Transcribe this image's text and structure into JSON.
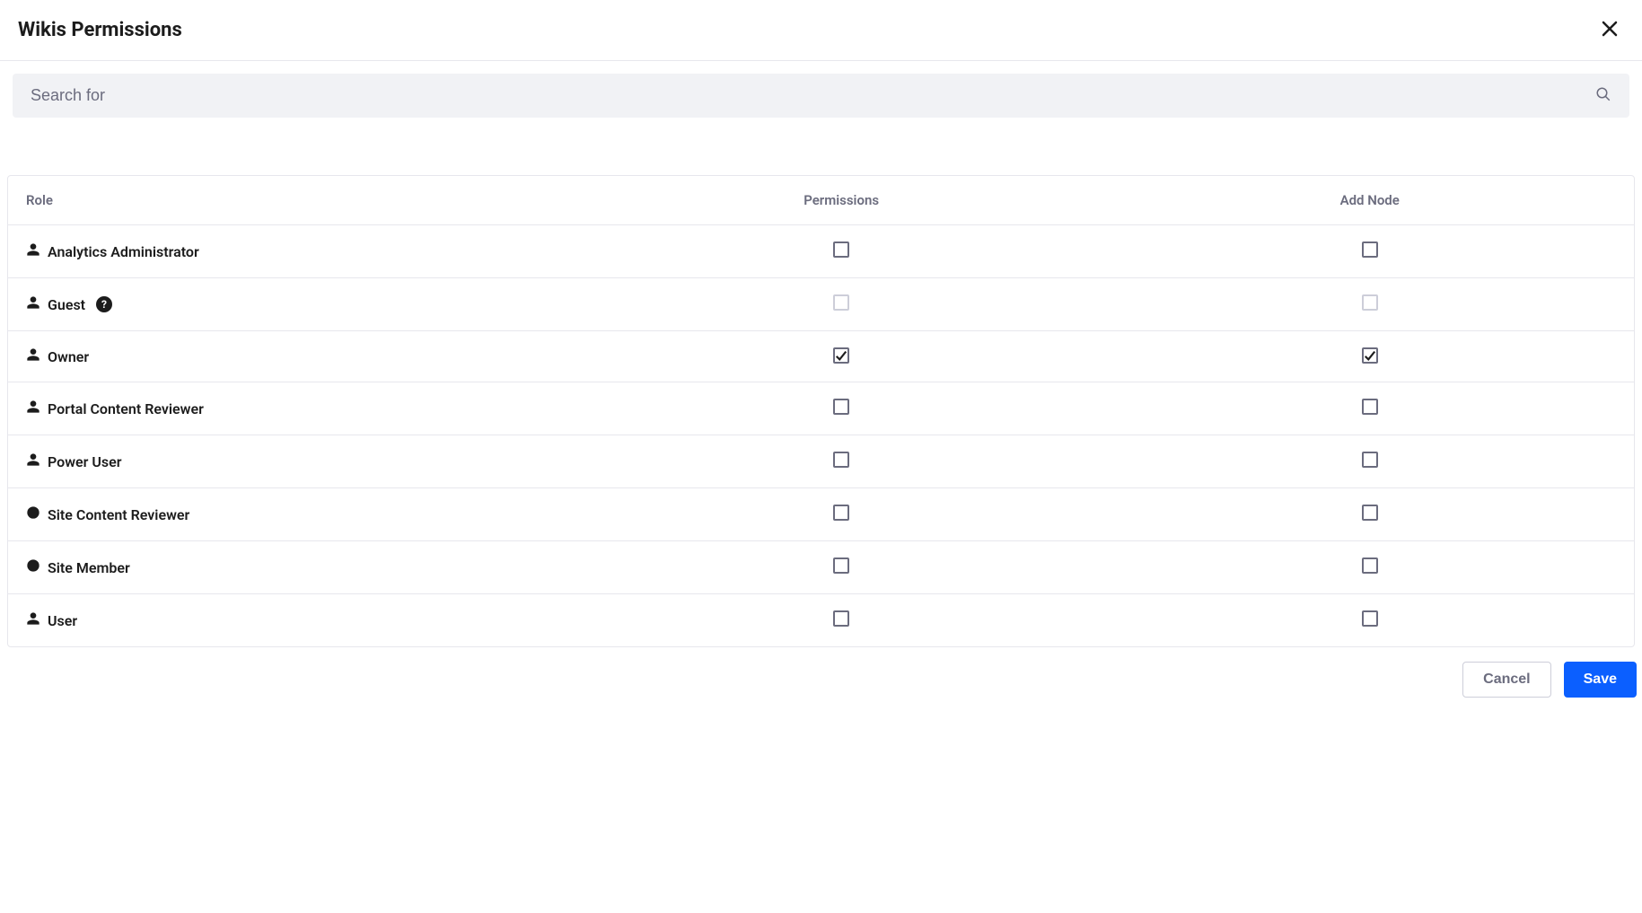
{
  "header": {
    "title": "Wikis Permissions"
  },
  "search": {
    "placeholder": "Search for"
  },
  "table": {
    "columns": {
      "role": "Role",
      "permissions": "Permissions",
      "addNode": "Add Node"
    },
    "rows": [
      {
        "iconType": "user",
        "label": "Analytics Administrator",
        "hasHelp": false,
        "permissions": false,
        "addNode": false,
        "disabled": false
      },
      {
        "iconType": "user",
        "label": "Guest",
        "hasHelp": true,
        "permissions": false,
        "addNode": false,
        "disabled": true
      },
      {
        "iconType": "user",
        "label": "Owner",
        "hasHelp": false,
        "permissions": true,
        "addNode": true,
        "disabled": false
      },
      {
        "iconType": "user",
        "label": "Portal Content Reviewer",
        "hasHelp": false,
        "permissions": false,
        "addNode": false,
        "disabled": false
      },
      {
        "iconType": "user",
        "label": "Power User",
        "hasHelp": false,
        "permissions": false,
        "addNode": false,
        "disabled": false
      },
      {
        "iconType": "site",
        "label": "Site Content Reviewer",
        "hasHelp": false,
        "permissions": false,
        "addNode": false,
        "disabled": false
      },
      {
        "iconType": "site",
        "label": "Site Member",
        "hasHelp": false,
        "permissions": false,
        "addNode": false,
        "disabled": false
      },
      {
        "iconType": "user",
        "label": "User",
        "hasHelp": false,
        "permissions": false,
        "addNode": false,
        "disabled": false
      }
    ]
  },
  "footer": {
    "cancel": "Cancel",
    "save": "Save"
  }
}
